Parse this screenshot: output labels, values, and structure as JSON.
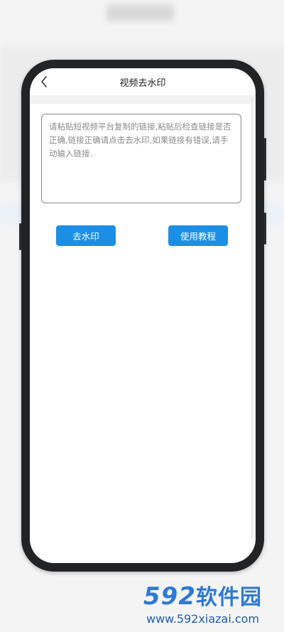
{
  "app": {
    "title": "视频去水印"
  },
  "icons": {
    "back": "chevron-left-icon"
  },
  "input": {
    "placeholder": "请粘贴短视频平台复制的链接,粘贴后检查链接是否正确,链接正确请点击去水印,如果链接有错误,请手动输入链接."
  },
  "actions": {
    "remove_watermark": "去水印",
    "tutorial": "使用教程"
  },
  "colors": {
    "accent": "#1b8fe6",
    "phone_frame": "#222325",
    "watermark_blue": "#2f79d3"
  },
  "watermark": {
    "logo_number": "592",
    "logo_text": "软件园",
    "url": "www.592xiazai.com"
  }
}
